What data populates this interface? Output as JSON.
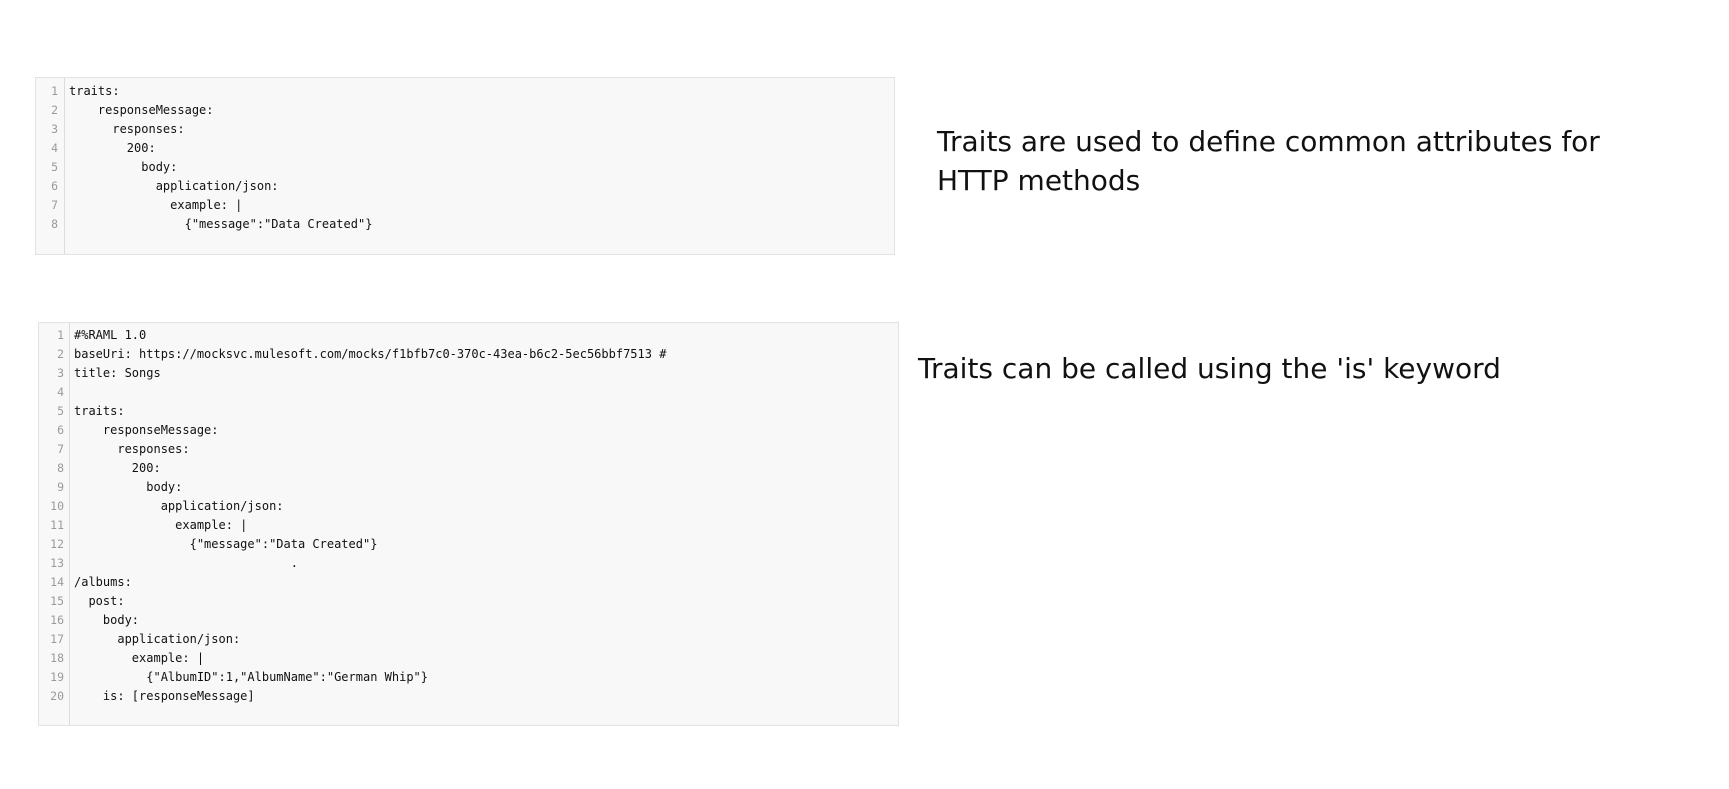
{
  "snippet_1": {
    "lines": [
      {
        "no": "1",
        "text": "traits:"
      },
      {
        "no": "2",
        "text": "    responseMessage:"
      },
      {
        "no": "3",
        "text": "      responses:"
      },
      {
        "no": "4",
        "text": "        200:"
      },
      {
        "no": "5",
        "text": "          body:"
      },
      {
        "no": "6",
        "text": "            application/json:"
      },
      {
        "no": "7",
        "text": "              example: |"
      },
      {
        "no": "8",
        "text": "                {\"message\":\"Data Created\"}"
      }
    ]
  },
  "caption_1": "Traits are used to define common attributes for HTTP methods",
  "snippet_2": {
    "lines": [
      {
        "no": "1",
        "text": "#%RAML 1.0"
      },
      {
        "no": "2",
        "text": "baseUri: https://mocksvc.mulesoft.com/mocks/f1bfb7c0-370c-43ea-b6c2-5ec56bbf7513 #"
      },
      {
        "no": "3",
        "text": "title: Songs"
      },
      {
        "no": "4",
        "text": ""
      },
      {
        "no": "5",
        "text": "traits:"
      },
      {
        "no": "6",
        "text": "    responseMessage:"
      },
      {
        "no": "7",
        "text": "      responses:"
      },
      {
        "no": "8",
        "text": "        200:"
      },
      {
        "no": "9",
        "text": "          body:"
      },
      {
        "no": "10",
        "text": "            application/json:"
      },
      {
        "no": "11",
        "text": "              example: |"
      },
      {
        "no": "12",
        "text": "                {\"message\":\"Data Created\"}"
      },
      {
        "no": "13",
        "text": "                              ."
      },
      {
        "no": "14",
        "text": "/albums:"
      },
      {
        "no": "15",
        "text": "  post:"
      },
      {
        "no": "16",
        "text": "    body:"
      },
      {
        "no": "17",
        "text": "      application/json:"
      },
      {
        "no": "18",
        "text": "        example: |"
      },
      {
        "no": "19",
        "text": "          {\"AlbumID\":1,\"AlbumName\":\"German Whip\"}"
      },
      {
        "no": "20",
        "text": "    is: [responseMessage]"
      }
    ]
  },
  "caption_2": "Traits can be called using the 'is' keyword"
}
